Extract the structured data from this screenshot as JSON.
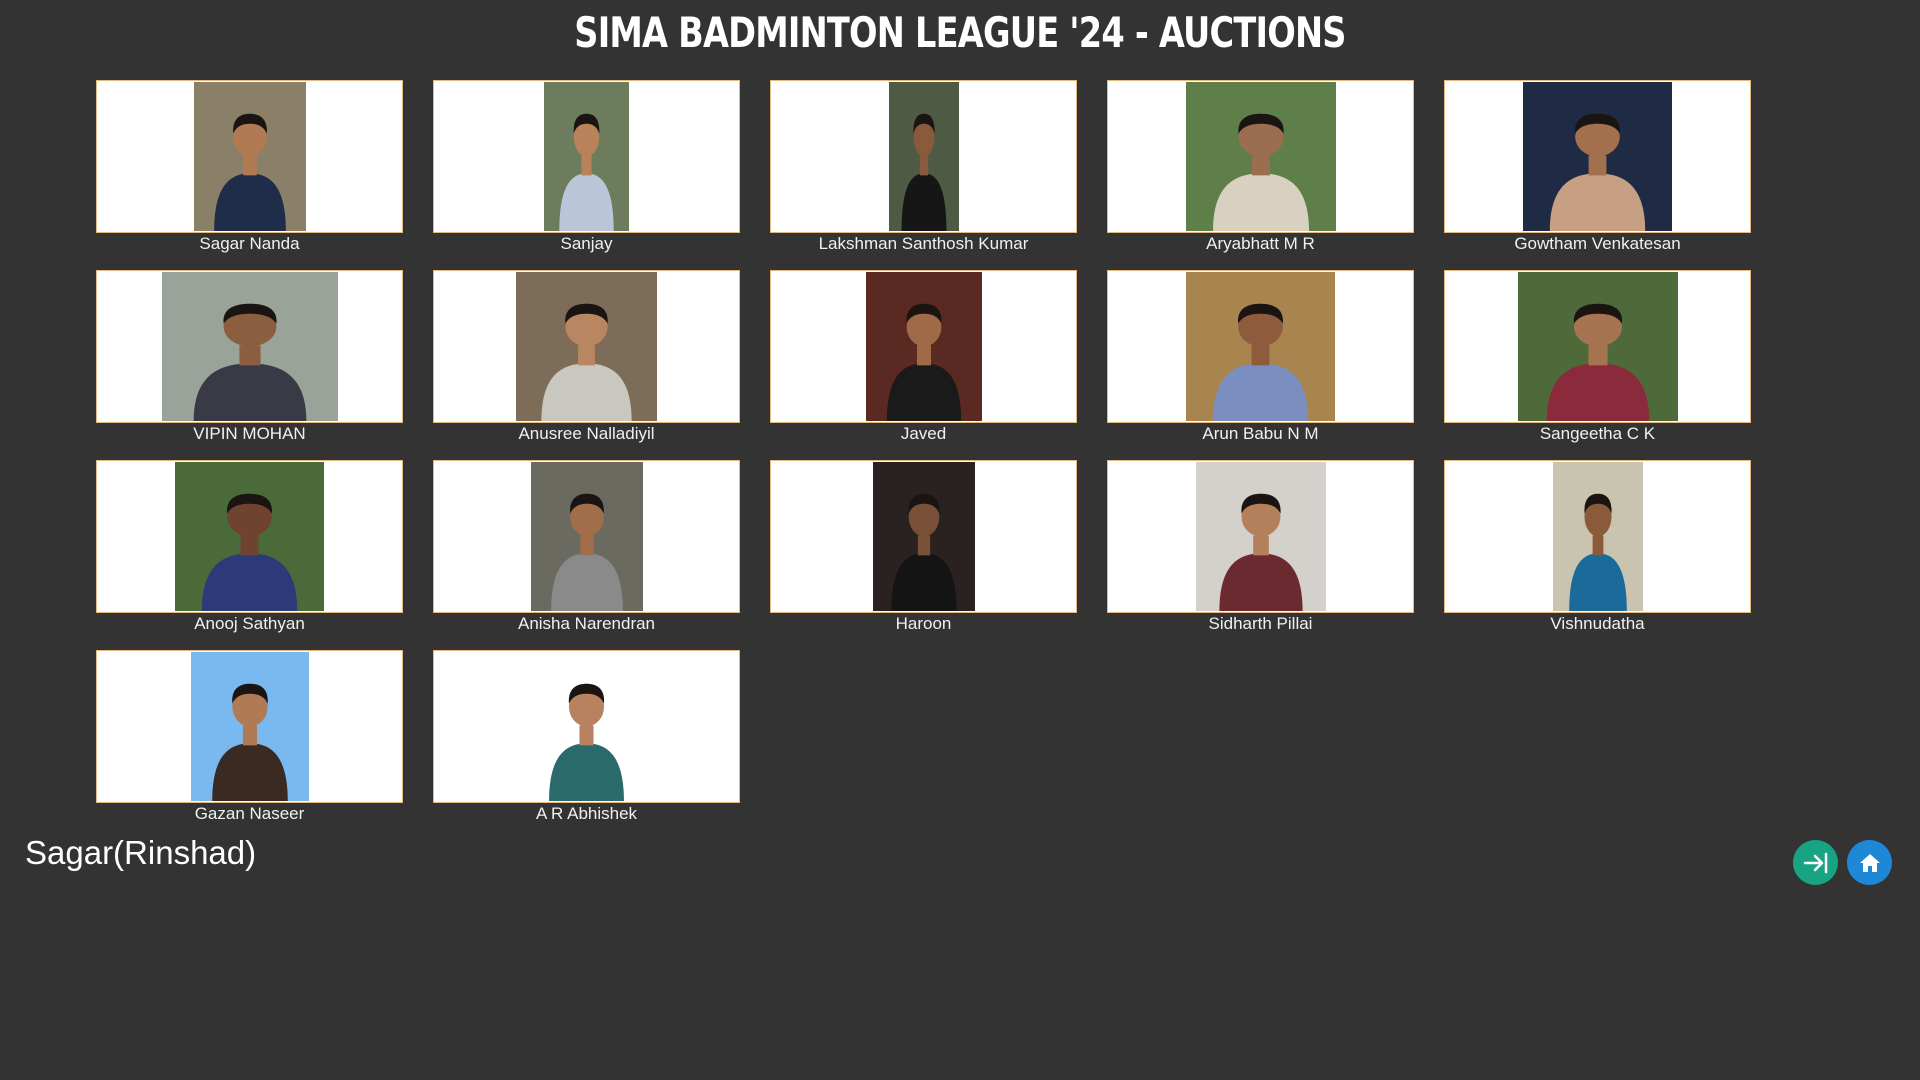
{
  "header": {
    "title": "SIMA BADMINTON LEAGUE '24 - AUCTIONS"
  },
  "players": [
    {
      "name": "Sagar Nanda",
      "photo": {
        "bg": "#8a8068",
        "shirt": "#1f2c4a",
        "skin": "#b07a52"
      }
    },
    {
      "name": "Sanjay",
      "photo": {
        "bg": "#6d7c5c",
        "shirt": "#b9c6d8",
        "skin": "#b9825a"
      }
    },
    {
      "name": "Lakshman Santhosh Kumar",
      "photo": {
        "bg": "#4f5a44",
        "shirt": "#161616",
        "skin": "#8a5a3c"
      }
    },
    {
      "name": "Aryabhatt M R",
      "photo": {
        "bg": "#5f7f4a",
        "shirt": "#d8d0c0",
        "skin": "#9a6e4e"
      }
    },
    {
      "name": "Gowtham Venkatesan",
      "photo": {
        "bg": "#1f2b44",
        "shirt": "#c7a084",
        "skin": "#a2704c"
      }
    },
    {
      "name": "VIPIN MOHAN",
      "photo": {
        "bg": "#9aa39a",
        "shirt": "#3a3a46",
        "skin": "#8c5e40"
      }
    },
    {
      "name": "Anusree Nalladiyil",
      "photo": {
        "bg": "#7d6c58",
        "shirt": "#c8c8c0",
        "skin": "#b88660"
      }
    },
    {
      "name": "Javed",
      "photo": {
        "bg": "#5a2a22",
        "shirt": "#1a1a1a",
        "skin": "#a06a48"
      }
    },
    {
      "name": "Arun Babu N M",
      "photo": {
        "bg": "#a8844e",
        "shirt": "#7a8fc0",
        "skin": "#8e5c3c"
      }
    },
    {
      "name": "Sangeetha C K",
      "photo": {
        "bg": "#4f6a3a",
        "shirt": "#8a2a3a",
        "skin": "#a67450"
      }
    },
    {
      "name": "Anooj Sathyan",
      "photo": {
        "bg": "#4a6a3a",
        "shirt": "#2c3a7a",
        "skin": "#6e4430"
      }
    },
    {
      "name": "Anisha Narendran",
      "photo": {
        "bg": "#6a6a60",
        "shirt": "#8a8a8a",
        "skin": "#a26e4a"
      }
    },
    {
      "name": "Haroon",
      "photo": {
        "bg": "#2a2220",
        "shirt": "#141414",
        "skin": "#7a5038"
      }
    },
    {
      "name": "Sidharth Pillai",
      "photo": {
        "bg": "#d4d0cc",
        "shirt": "#6a2a30",
        "skin": "#b4805c"
      }
    },
    {
      "name": "Vishnudatha",
      "photo": {
        "bg": "#c8c4b0",
        "shirt": "#1a6a9a",
        "skin": "#8a5a3a"
      }
    },
    {
      "name": "Gazan Naseer",
      "photo": {
        "bg": "#7ab8f0",
        "shirt": "#3a2a22",
        "skin": "#b07a54"
      }
    },
    {
      "name": "A R Abhishek",
      "photo": {
        "bg": "#ffffff",
        "shirt": "#2a6a6a",
        "skin": "#b88260"
      }
    }
  ],
  "current_bidder": "Sagar(Rinshad)",
  "actions": {
    "next_icon": "arrow-right-to-bar-icon",
    "home_icon": "home-icon",
    "next_color": "#18a383",
    "home_color": "#1e88d6"
  }
}
